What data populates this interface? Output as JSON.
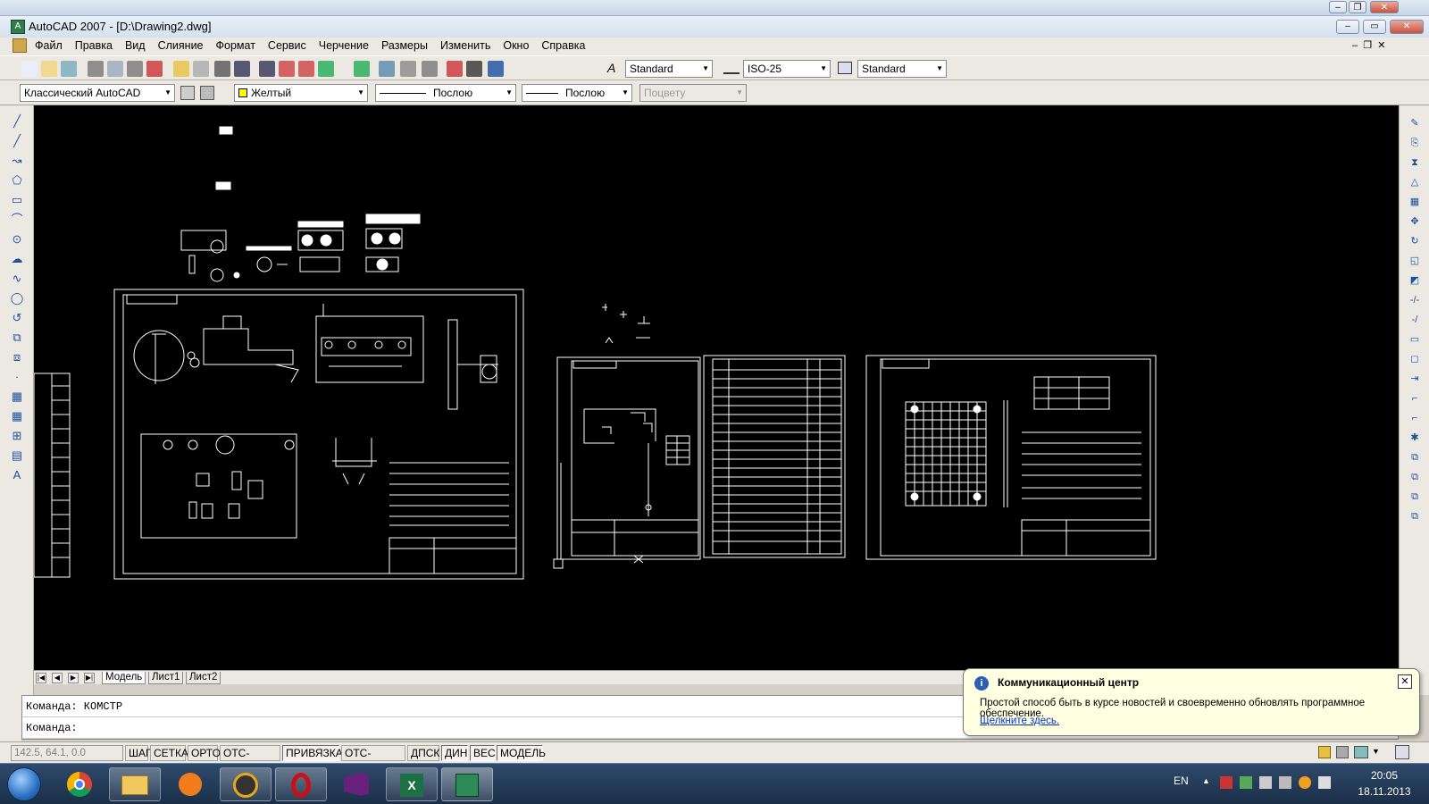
{
  "window": {
    "title": "AutoCAD 2007 - [D:\\Drawing2.dwg]"
  },
  "menu": [
    "Файл",
    "Правка",
    "Вид",
    "Слияние",
    "Формат",
    "Сервис",
    "Черчение",
    "Размеры",
    "Изменить",
    "Окно",
    "Справка"
  ],
  "toolbar": {
    "text_style": "Standard",
    "dim_style": "ISO-25",
    "table_style": "Standard",
    "workspace": "Классический AutoCAD",
    "layer": "Желтый",
    "linetype": "Послою",
    "lineweight": "Послою",
    "plotstyle": "Поцвету"
  },
  "tabs": {
    "model": "Модель",
    "layout1": "Лист1",
    "layout2": "Лист2"
  },
  "command": {
    "line1": "Команда:  КОМСТР",
    "line2": "Команда:"
  },
  "status": {
    "coords": "142.5, 64.1, 0.0",
    "buttons": [
      "ШАГ",
      "СЕТКА",
      "ОРТО",
      "ОТС-ПОЛЯР",
      "ПРИВЯЗКА",
      "ОТС-ОБЪЕКТ",
      "ДПСК",
      "ДИН",
      "ВЕС",
      "МОДЕЛЬ"
    ]
  },
  "balloon": {
    "title": "Коммуникационный центр",
    "text": "Простой способ быть в курсе новостей и своевременно обновлять программное обеспечение.",
    "link": "Щелкните здесь."
  },
  "taskbar": {
    "lang": "EN",
    "time": "20:05",
    "date": "18.11.2013",
    "apps": [
      "start-orb",
      "chrome-icon",
      "explorer-icon",
      "avast-icon",
      "autocad-icon",
      "opera-icon",
      "visual-studio-icon",
      "excel-icon",
      "autocad-drawing-icon"
    ]
  },
  "colors": {
    "canvas": "#000000",
    "layer_swatch": "#ffff00",
    "balloon_bg": "#ffffe1",
    "taskbar": "#1f3552"
  }
}
